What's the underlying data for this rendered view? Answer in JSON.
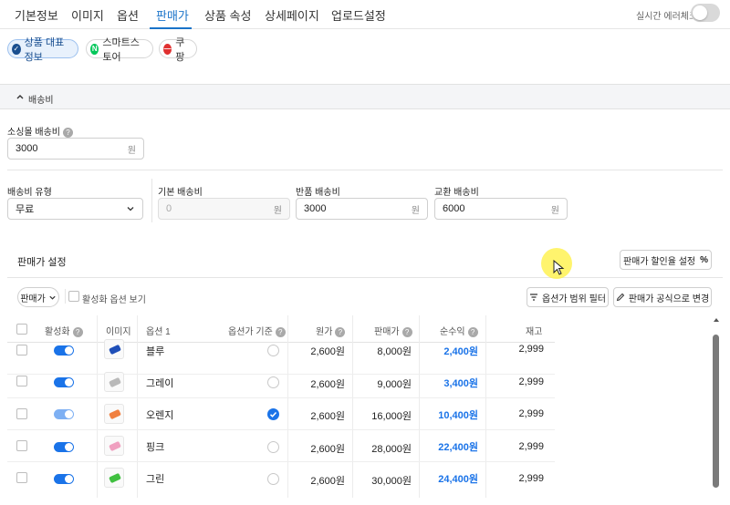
{
  "tabs": [
    "기본정보",
    "이미지",
    "옵션",
    "판매가",
    "상품 속성",
    "상세페이지",
    "업로드설정"
  ],
  "realtime_check": {
    "label": "실시간 에러체크",
    "on": false
  },
  "channels": [
    {
      "label": "상품 대표정보",
      "icon": "check-circle-icon",
      "active": true
    },
    {
      "label": "스마트스토어",
      "icon": "naver-n-icon",
      "active": false
    },
    {
      "label": "쿠팡",
      "icon": "coupang-icon",
      "active": false
    }
  ],
  "shipping": {
    "section_title": "배송비",
    "mall_fee_label": "소싱몰 배송비",
    "mall_fee_value": "3000",
    "unit": "원",
    "type_label": "배송비 유형",
    "type_value": "무료",
    "base_label": "기본 배송비",
    "base_placeholder": "0",
    "return_label": "반품 배송비",
    "return_value": "3000",
    "exchange_label": "교환 배송비",
    "exchange_value": "6000"
  },
  "pricing": {
    "title": "판매가 설정",
    "discount_btn": "판매가 할인율 설정",
    "dropdown": "판매가",
    "active_only_label": "활성화 옵션 보기",
    "range_filter_btn": "옵션가 범위 필터",
    "formula_btn": "판매가 공식으로 변경"
  },
  "table": {
    "headers": [
      "활성화",
      "이미지",
      "옵션 1",
      "옵션가 기준",
      "원가",
      "판매가",
      "순수익",
      "재고"
    ],
    "rows": [
      {
        "option": "블루",
        "cost": "2,600원",
        "price": "8,000원",
        "profit": "2,400원",
        "stock": "2,999",
        "active": true,
        "basis": false,
        "color": "#1f4fb8"
      },
      {
        "option": "그레이",
        "cost": "2,600원",
        "price": "9,000원",
        "profit": "3,400원",
        "stock": "2,999",
        "active": true,
        "basis": false,
        "color": "#b9b9b9"
      },
      {
        "option": "오렌지",
        "cost": "2,600원",
        "price": "16,000원",
        "profit": "10,400원",
        "stock": "2,999",
        "active": true,
        "basis": true,
        "color": "#f08040"
      },
      {
        "option": "핑크",
        "cost": "2,600원",
        "price": "28,000원",
        "profit": "22,400원",
        "stock": "2,999",
        "active": true,
        "basis": false,
        "color": "#f0a0c0"
      },
      {
        "option": "그린",
        "cost": "2,600원",
        "price": "30,000원",
        "profit": "24,400원",
        "stock": "2,999",
        "active": true,
        "basis": false,
        "color": "#40c040"
      }
    ]
  }
}
